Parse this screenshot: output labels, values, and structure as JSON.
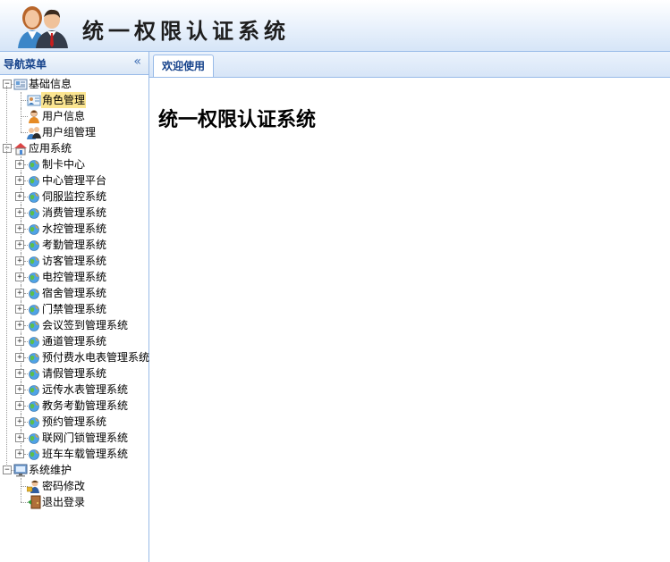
{
  "header": {
    "title": "统一权限认证系统"
  },
  "nav": {
    "title": "导航菜单",
    "collapse_glyph": "«",
    "groups": [
      {
        "label": "基础信息",
        "icon": "info-card-icon",
        "expanded": true,
        "items": [
          {
            "label": "角色管理",
            "icon": "role-card-icon",
            "selected": true
          },
          {
            "label": "用户信息",
            "icon": "user-icon"
          },
          {
            "label": "用户组管理",
            "icon": "user-group-icon"
          }
        ]
      },
      {
        "label": "应用系统",
        "icon": "app-home-icon",
        "expanded": true,
        "items": [
          {
            "label": "制卡中心"
          },
          {
            "label": "中心管理平台"
          },
          {
            "label": "伺服监控系统"
          },
          {
            "label": "消费管理系统"
          },
          {
            "label": "水控管理系统"
          },
          {
            "label": "考勤管理系统"
          },
          {
            "label": "访客管理系统"
          },
          {
            "label": "电控管理系统"
          },
          {
            "label": "宿舍管理系统"
          },
          {
            "label": "门禁管理系统"
          },
          {
            "label": "会议签到管理系统"
          },
          {
            "label": "通道管理系统"
          },
          {
            "label": "预付费水电表管理系统"
          },
          {
            "label": "请假管理系统"
          },
          {
            "label": "远传水表管理系统"
          },
          {
            "label": "教务考勤管理系统"
          },
          {
            "label": "预约管理系统"
          },
          {
            "label": "联网门锁管理系统"
          },
          {
            "label": "班车车载管理系统"
          }
        ]
      },
      {
        "label": "系统维护",
        "icon": "monitor-icon",
        "expanded": true,
        "items": [
          {
            "label": "密码修改",
            "icon": "password-user-icon"
          },
          {
            "label": "退出登录",
            "icon": "logout-door-icon"
          }
        ]
      }
    ]
  },
  "tabs": [
    {
      "label": "欢迎使用",
      "active": true
    }
  ],
  "content": {
    "heading": "统一权限认证系统"
  },
  "colors": {
    "border": "#99bbe8",
    "selected": "#fbe591",
    "nav_title": "#15428b"
  }
}
